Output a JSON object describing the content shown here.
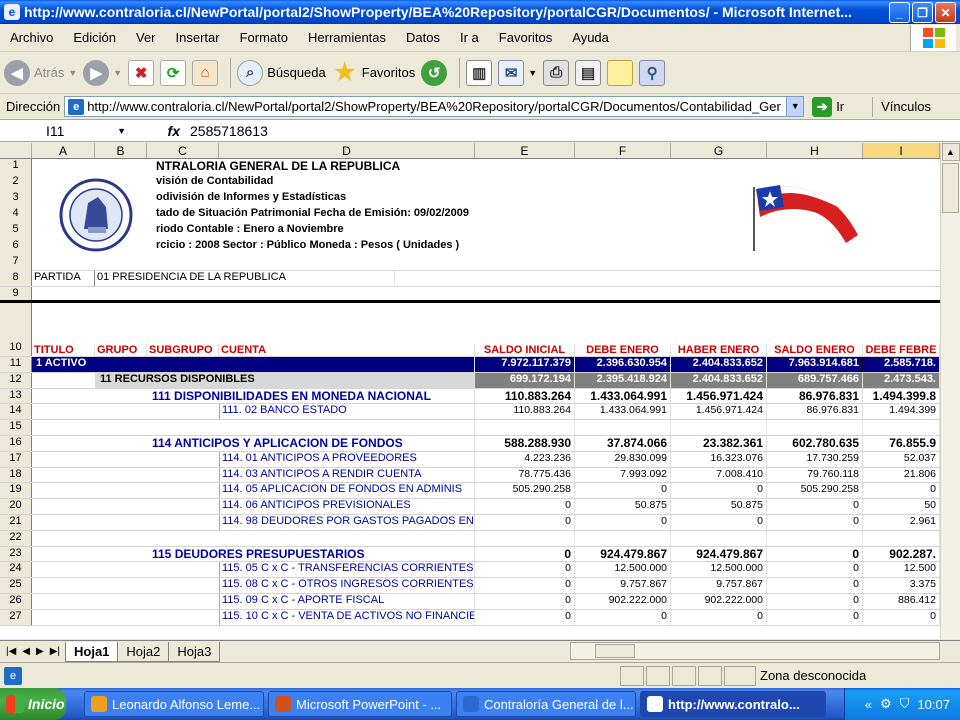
{
  "window": {
    "title": "http://www.contraloria.cl/NewPortal/portal2/ShowProperty/BEA%20Repository/portalCGR/Documentos/ - Microsoft Internet..."
  },
  "menu": [
    "Archivo",
    "Edición",
    "Ver",
    "Insertar",
    "Formato",
    "Herramientas",
    "Datos",
    "Ir a",
    "Favoritos",
    "Ayuda"
  ],
  "toolbar": {
    "back_label": "Atrás",
    "search_label": "Búsqueda",
    "favorites_label": "Favoritos"
  },
  "address": {
    "label": "Dirección",
    "url": "http://www.contraloria.cl/NewPortal/portal2/ShowProperty/BEA%20Repository/portalCGR/Documentos/Contabilidad_Ger",
    "go_label": "Ir",
    "links_label": "Vínculos"
  },
  "formula_bar": {
    "cell": "I11",
    "fx": "fx",
    "value": "2585718613"
  },
  "columns": [
    "A",
    "B",
    "C",
    "D",
    "E",
    "F",
    "G",
    "H",
    "I"
  ],
  "header": {
    "line1": "NTRALORIA GENERAL DE LA REPUBLICA",
    "line2": "visión de Contabilidad",
    "line3": "odivisión de Informes y Estadísticas",
    "line4": "tado de Situación Patrimonial     Fecha de Emisión:  09/02/2009",
    "line5": "riodo Contable : Enero a Noviembre",
    "line6": "rcicio : 2008    Sector : Público    Moneda : Pesos ( Unidades )"
  },
  "partida": {
    "label": "PARTIDA",
    "value": "01 PRESIDENCIA DE LA REPUBLICA"
  },
  "col_headers": {
    "titulo": "TITULO",
    "grupo": "GRUPO",
    "subgrupo": "SUBGRUPO",
    "cuenta": "CUENTA",
    "e": "SALDO INICIAL",
    "f": "DEBE ENERO",
    "g": "HABER ENERO",
    "h": "SALDO ENERO",
    "i": "DEBE FEBRE"
  },
  "rows": [
    {
      "n": "11",
      "label": "1 ACTIVO",
      "style": "navy",
      "e": "7.972.117.379",
      "f": "2.396.630.954",
      "g": "2.404.833.652",
      "h": "7.963.914.681",
      "i": "2.585.718."
    },
    {
      "n": "12",
      "label": "11 RECURSOS DISPONIBLES",
      "style": "grey",
      "e": "699.172.194",
      "f": "2.395.418.924",
      "g": "2.404.833.652",
      "h": "689.757.466",
      "i": "2.473.543."
    },
    {
      "n": "13",
      "label": "111 DISPONIBILIDADES EN MONEDA NACIONAL",
      "style": "sub",
      "e": "110.883.264",
      "f": "1.433.064.991",
      "g": "1.456.971.424",
      "h": "86.976.831",
      "i": "1.494.399.8"
    },
    {
      "n": "14",
      "label": "111. 02 BANCO ESTADO",
      "style": "acct",
      "e": "110.883.264",
      "f": "1.433.064.991",
      "g": "1.456.971.424",
      "h": "86.976.831",
      "i": "1.494.399"
    },
    {
      "n": "15",
      "label": "",
      "style": "empty",
      "e": "",
      "f": "",
      "g": "",
      "h": "",
      "i": ""
    },
    {
      "n": "16",
      "label": "114 ANTICIPOS Y APLICACION DE FONDOS",
      "style": "sub",
      "e": "588.288.930",
      "f": "37.874.066",
      "g": "23.382.361",
      "h": "602.780.635",
      "i": "76.855.9"
    },
    {
      "n": "17",
      "label": "114. 01 ANTICIPOS A PROVEEDORES",
      "style": "acct",
      "e": "4.223.236",
      "f": "29.830.099",
      "g": "16.323.076",
      "h": "17.730.259",
      "i": "52.037"
    },
    {
      "n": "18",
      "label": "114. 03 ANTICIPOS A RENDIR CUENTA",
      "style": "acct",
      "e": "78.775.436",
      "f": "7.993.092",
      "g": "7.008.410",
      "h": "79.760.118",
      "i": "21.806"
    },
    {
      "n": "19",
      "label": "114. 05 APLICACION DE FONDOS EN ADMINIS",
      "style": "acct",
      "e": "505.290.258",
      "f": "0",
      "g": "0",
      "h": "505.290.258",
      "i": "0"
    },
    {
      "n": "20",
      "label": "114. 06 ANTICIPOS PREVISIONALES",
      "style": "acct",
      "e": "0",
      "f": "50.875",
      "g": "50.875",
      "h": "0",
      "i": "50"
    },
    {
      "n": "21",
      "label": "114. 98 DEUDORES POR GASTOS PAGADOS EN",
      "style": "acct",
      "e": "0",
      "f": "0",
      "g": "0",
      "h": "0",
      "i": "2.961"
    },
    {
      "n": "22",
      "label": "",
      "style": "empty",
      "e": "",
      "f": "",
      "g": "",
      "h": "",
      "i": ""
    },
    {
      "n": "23",
      "label": "115 DEUDORES PRESUPUESTARIOS",
      "style": "sub",
      "e": "0",
      "f": "924.479.867",
      "g": "924.479.867",
      "h": "0",
      "i": "902.287."
    },
    {
      "n": "24",
      "label": "115. 05 C x C - TRANSFERENCIAS CORRIENTES",
      "style": "acct",
      "e": "0",
      "f": "12.500.000",
      "g": "12.500.000",
      "h": "0",
      "i": "12.500"
    },
    {
      "n": "25",
      "label": "115. 08 C x C - OTROS INGRESOS CORRIENTES",
      "style": "acct",
      "e": "0",
      "f": "9.757.867",
      "g": "9.757.867",
      "h": "0",
      "i": "3.375"
    },
    {
      "n": "26",
      "label": "115. 09 C x C - APORTE FISCAL",
      "style": "acct",
      "e": "0",
      "f": "902.222.000",
      "g": "902.222.000",
      "h": "0",
      "i": "886.412"
    },
    {
      "n": "27",
      "label": "115. 10 C x C - VENTA DE ACTIVOS NO FINANCIE",
      "style": "acct",
      "e": "0",
      "f": "0",
      "g": "0",
      "h": "0",
      "i": "0"
    }
  ],
  "sheet_tabs": [
    "Hoja1",
    "Hoja2",
    "Hoja3"
  ],
  "status": {
    "zone": "Zona desconocida"
  },
  "taskbar": {
    "start": "Inicio",
    "tasks": [
      "Leonardo Alfonso Leme...",
      "Microsoft PowerPoint - ...",
      "Contraloría General de l...",
      "http://www.contralo..."
    ],
    "chevron": "«",
    "clock": "10:07"
  },
  "colors": {
    "accent_navy": "#000080",
    "header_red": "#cc0000",
    "account_blue": "#0000a0"
  }
}
